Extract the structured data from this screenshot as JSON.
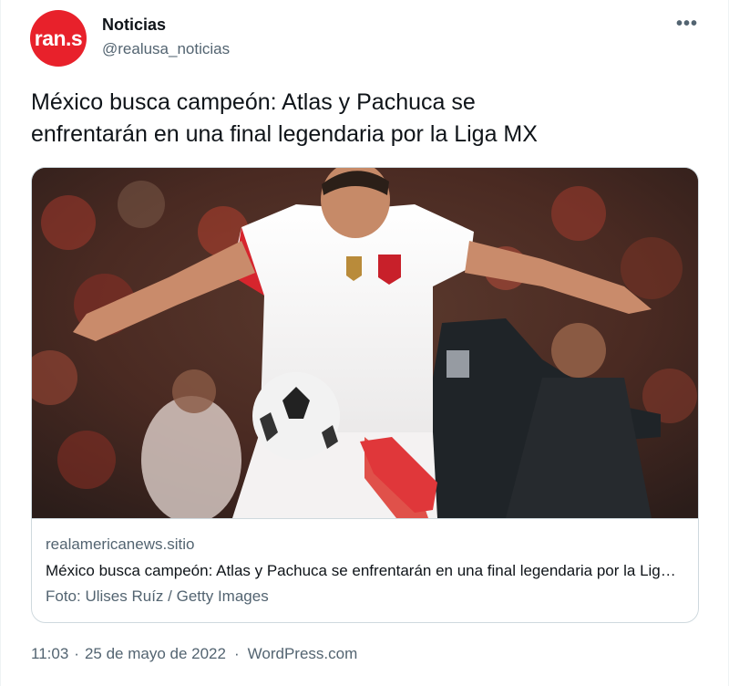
{
  "author": {
    "avatar_text": "ran.s",
    "display_name": "Noticias",
    "handle": "@realusa_noticias",
    "avatar_color": "#e8212b"
  },
  "more_icon": "more-horizontal-icon",
  "tweet": {
    "text": "México busca campeón: Atlas y Pachuca se\nenfrentarán en una final legendaria por la Liga MX"
  },
  "card": {
    "image_description_icon": "soccer-photo",
    "domain": "realamericanews.sitio",
    "title": "México busca campeón: Atlas y Pachuca se enfrentarán en una final legendaria por la Liga MX",
    "description": "Foto: Ulises Ruíz / Getty Images"
  },
  "meta": {
    "time": "11:03",
    "date": "25 de mayo de 2022",
    "separator": "·",
    "source": "WordPress.com"
  },
  "colors": {
    "text_primary": "#0f1419",
    "text_secondary": "#536471",
    "border": "#cfd9de"
  }
}
